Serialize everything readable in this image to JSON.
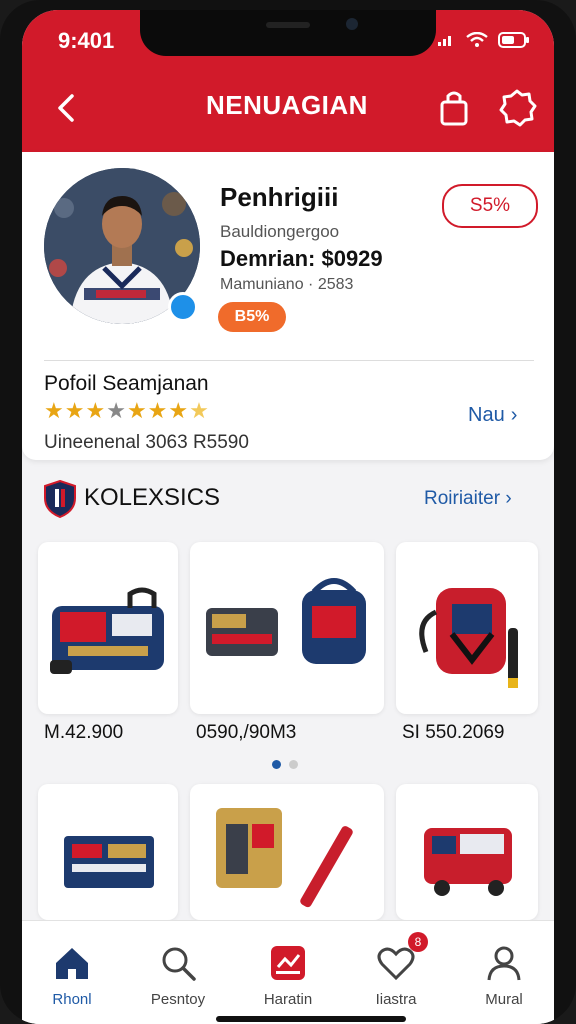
{
  "status_bar": {
    "time": "9:401"
  },
  "header": {
    "title": "NENUAGIAN"
  },
  "profile": {
    "name": "Penhrigiii",
    "subtitle": "Bauldiongergoo",
    "demo_line": "Demrian: $0929",
    "member_line": "Mamuniano · 2583",
    "pill": "B5%",
    "percent_badge": "S5%",
    "section_title": "Pofoil Seamjanan",
    "rating": 4.5,
    "link_label": "Nau",
    "footnote": "Uineenenal 3063 R5590"
  },
  "collection": {
    "title": "KOLEXSICS",
    "link_label": "Roiriaiter"
  },
  "products": [
    {
      "price": "M.42.900"
    },
    {
      "price": "0590,/90M3"
    },
    {
      "price": "SI 550.2069"
    },
    {
      "price": ""
    },
    {
      "price": ""
    },
    {
      "price": ""
    }
  ],
  "tabs": [
    {
      "label": "Rhonl",
      "icon": "home-icon",
      "active": true
    },
    {
      "label": "Pesntoy",
      "icon": "search-icon"
    },
    {
      "label": "Haratin",
      "icon": "chart-icon"
    },
    {
      "label": "Iiastra",
      "icon": "heart-icon",
      "badge": "8"
    },
    {
      "label": "Mural",
      "icon": "user-icon"
    }
  ],
  "colors": {
    "brand_red": "#d11a2a",
    "link_blue": "#1f5aa6",
    "pill_orange": "#f06b2b",
    "online_blue": "#1e90e8"
  }
}
